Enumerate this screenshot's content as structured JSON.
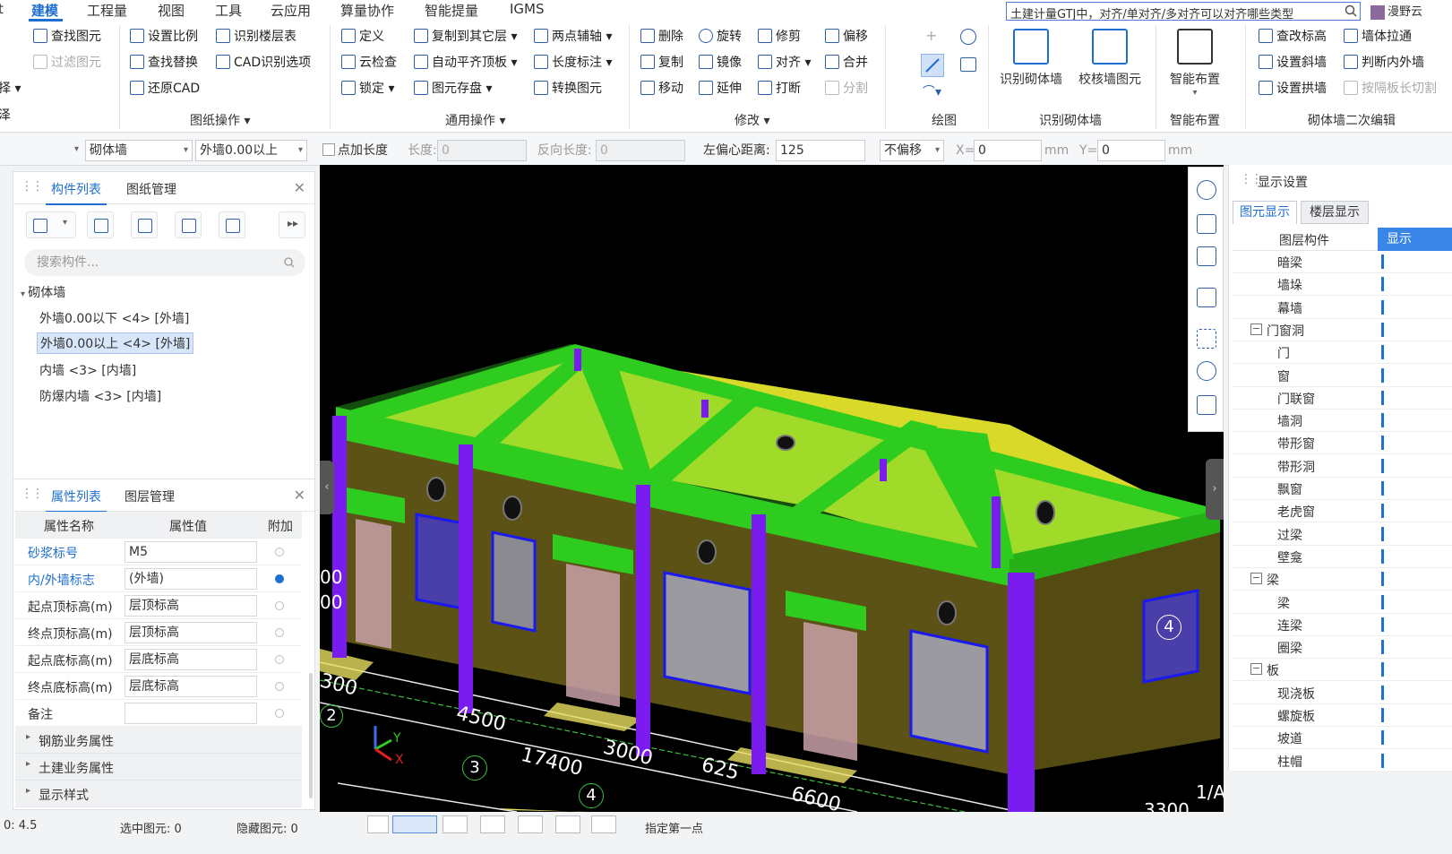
{
  "menu": {
    "items": [
      "建模",
      "工程量",
      "视图",
      "工具",
      "云应用",
      "算量协作",
      "智能提量",
      "IGMS"
    ],
    "active_index": 0,
    "cut_left": "t",
    "search_text": "土建计量GTJ中，对齐/单对齐/多对齐可以对齐哪些类型",
    "user": "漫野云"
  },
  "ribbon": {
    "g0": {
      "a": "查找图元",
      "b": "过滤图元",
      "c": "择",
      "d": "泽"
    },
    "g1": {
      "a": "设置比例",
      "b": "识别楼层表",
      "c": "查找替换",
      "d": "CAD识别选项",
      "e": "还原CAD",
      "label": "图纸操作"
    },
    "g2": {
      "a": "定义",
      "b": "复制到其它层",
      "c": "两点辅轴",
      "d": "云检查",
      "e": "自动平齐顶板",
      "f": "长度标注",
      "g": "锁定",
      "h": "图元存盘",
      "i": "转换图元",
      "label": "通用操作"
    },
    "g3": {
      "a": "删除",
      "b": "旋转",
      "c": "修剪",
      "d": "偏移",
      "e": "复制",
      "f": "镜像",
      "g": "对齐",
      "h": "合并",
      "i": "移动",
      "j": "延伸",
      "k": "打断",
      "l": "分割",
      "label": "修改"
    },
    "g4": {
      "label": "绘图"
    },
    "g5": {
      "a": "识别砌体墙",
      "b": "校核墙图元",
      "label": "识别砌体墙"
    },
    "g6": {
      "a": "智能布置",
      "label": "智能布置"
    },
    "g7": {
      "a": "查改标高",
      "b": "墙体拉通",
      "c": "设置斜墙",
      "d": "判断内外墙",
      "e": "设置拱墙",
      "f": "按隔板长切割",
      "label": "砌体墙二次编辑"
    }
  },
  "options": {
    "type": "砌体墙",
    "layer": "外墙0.00以上",
    "point_length": "点加长度",
    "length_label": "长度:",
    "length_value": "0",
    "rev_label": "反向长度:",
    "rev_value": "0",
    "offset_label": "左偏心距离:",
    "offset_value": "125",
    "no_offset": "不偏移",
    "x_label": "X=",
    "x_value": "0",
    "y_label": "Y=",
    "y_value": "0",
    "unit": "mm"
  },
  "component_panel": {
    "tab1": "构件列表",
    "tab2": "图纸管理",
    "search_placeholder": "搜索构件...",
    "category": "砌体墙",
    "items": [
      "外墙0.00以下 <4> [外墙]",
      "外墙0.00以上 <4> [外墙]",
      "内墙 <3> [内墙]",
      "防爆内墙 <3> [内墙]"
    ],
    "selected_index": 1
  },
  "property_panel": {
    "tab1": "属性列表",
    "tab2": "图层管理",
    "headers": [
      "属性名称",
      "属性值",
      "附加"
    ],
    "rows": [
      {
        "name": "砂浆标号",
        "value": "M5",
        "attached": false,
        "blue": true
      },
      {
        "name": "内/外墙标志",
        "value": "(外墙)",
        "attached": true,
        "blue": true
      },
      {
        "name": "起点顶标高(m)",
        "value": "层顶标高",
        "attached": false,
        "blue": false
      },
      {
        "name": "终点顶标高(m)",
        "value": "层顶标高",
        "attached": false,
        "blue": false
      },
      {
        "name": "起点底标高(m)",
        "value": "层底标高",
        "attached": false,
        "blue": false
      },
      {
        "name": "终点底标高(m)",
        "value": "层底标高",
        "attached": false,
        "blue": false
      },
      {
        "name": "备注",
        "value": "",
        "attached": false,
        "blue": false
      }
    ],
    "groups": [
      "钢筋业务属性",
      "土建业务属性",
      "显示样式"
    ]
  },
  "display_panel": {
    "title": "显示设置",
    "tab1": "图元显示",
    "tab2": "楼层显示",
    "col1": "图层构件",
    "col2": "显示",
    "rows": [
      {
        "label": "暗梁",
        "level": 2
      },
      {
        "label": "墙垛",
        "level": 2
      },
      {
        "label": "幕墙",
        "level": 2
      },
      {
        "label": "门窗洞",
        "level": 1
      },
      {
        "label": "门",
        "level": 2
      },
      {
        "label": "窗",
        "level": 2
      },
      {
        "label": "门联窗",
        "level": 2
      },
      {
        "label": "墙洞",
        "level": 2
      },
      {
        "label": "带形窗",
        "level": 2
      },
      {
        "label": "带形洞",
        "level": 2
      },
      {
        "label": "飘窗",
        "level": 2
      },
      {
        "label": "老虎窗",
        "level": 2
      },
      {
        "label": "过梁",
        "level": 2
      },
      {
        "label": "壁龛",
        "level": 2
      },
      {
        "label": "梁",
        "level": 1
      },
      {
        "label": "梁",
        "level": 2
      },
      {
        "label": "连梁",
        "level": 2
      },
      {
        "label": "圈梁",
        "level": 2
      },
      {
        "label": "板",
        "level": 1
      },
      {
        "label": "现浇板",
        "level": 2
      },
      {
        "label": "螺旋板",
        "level": 2
      },
      {
        "label": "坡道",
        "level": 2
      },
      {
        "label": "柱帽",
        "level": 2
      }
    ]
  },
  "viewport": {
    "dims": [
      "4500",
      "3000",
      "17400",
      "625",
      "6600",
      "300",
      "3300"
    ],
    "axis_numbers": [
      "2",
      "3",
      "4",
      "4"
    ],
    "axis_letter": "1/A",
    "side_labels": [
      "00",
      "00"
    ],
    "colors": {
      "beam": "#2ecc1e",
      "wall": "#5c5215",
      "column": "#7a1cf0",
      "slab": "#e6e62a"
    }
  },
  "status": {
    "left": "0: 4.5",
    "selected": "选中图元: 0",
    "hidden": "隐藏图元: 0",
    "snap": "指定第一点"
  }
}
